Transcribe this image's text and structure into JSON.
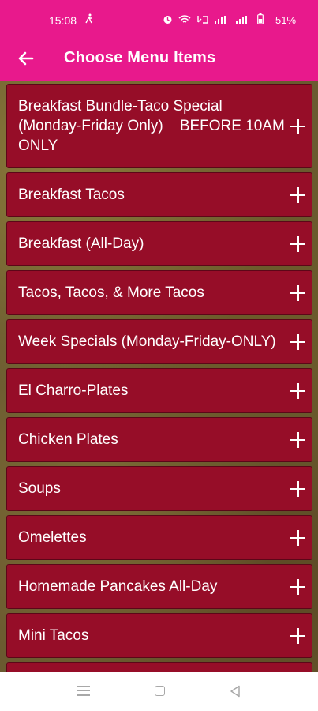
{
  "status_bar": {
    "time": "15:08",
    "battery_text": "51%",
    "icons": [
      "walk-icon",
      "alarm-icon",
      "wifi-icon",
      "volte-icon",
      "signal-icon",
      "signal-icon",
      "battery-icon"
    ]
  },
  "app_bar": {
    "title": "Choose Menu Items",
    "back_icon": "arrow-left-icon"
  },
  "colors": {
    "brand": "#e8198c",
    "item_bg": "#960d28"
  },
  "menu_items": [
    {
      "label": "Breakfast Bundle-Taco Special (Monday-Friday Only)    BEFORE 10AM ONLY"
    },
    {
      "label": "Breakfast Tacos"
    },
    {
      "label": "Breakfast (All-Day)"
    },
    {
      "label": "Tacos, Tacos, & More Tacos"
    },
    {
      "label": "Week Specials (Monday-Friday-ONLY)"
    },
    {
      "label": "El Charro-Plates"
    },
    {
      "label": "Chicken Plates"
    },
    {
      "label": "Soups"
    },
    {
      "label": "Omelettes"
    },
    {
      "label": "Homemade Pancakes All-Day"
    },
    {
      "label": "Mini Tacos"
    },
    {
      "label": ""
    }
  ],
  "nav_bar": {
    "icons": [
      "recent-apps-icon",
      "home-icon",
      "back-icon"
    ]
  }
}
